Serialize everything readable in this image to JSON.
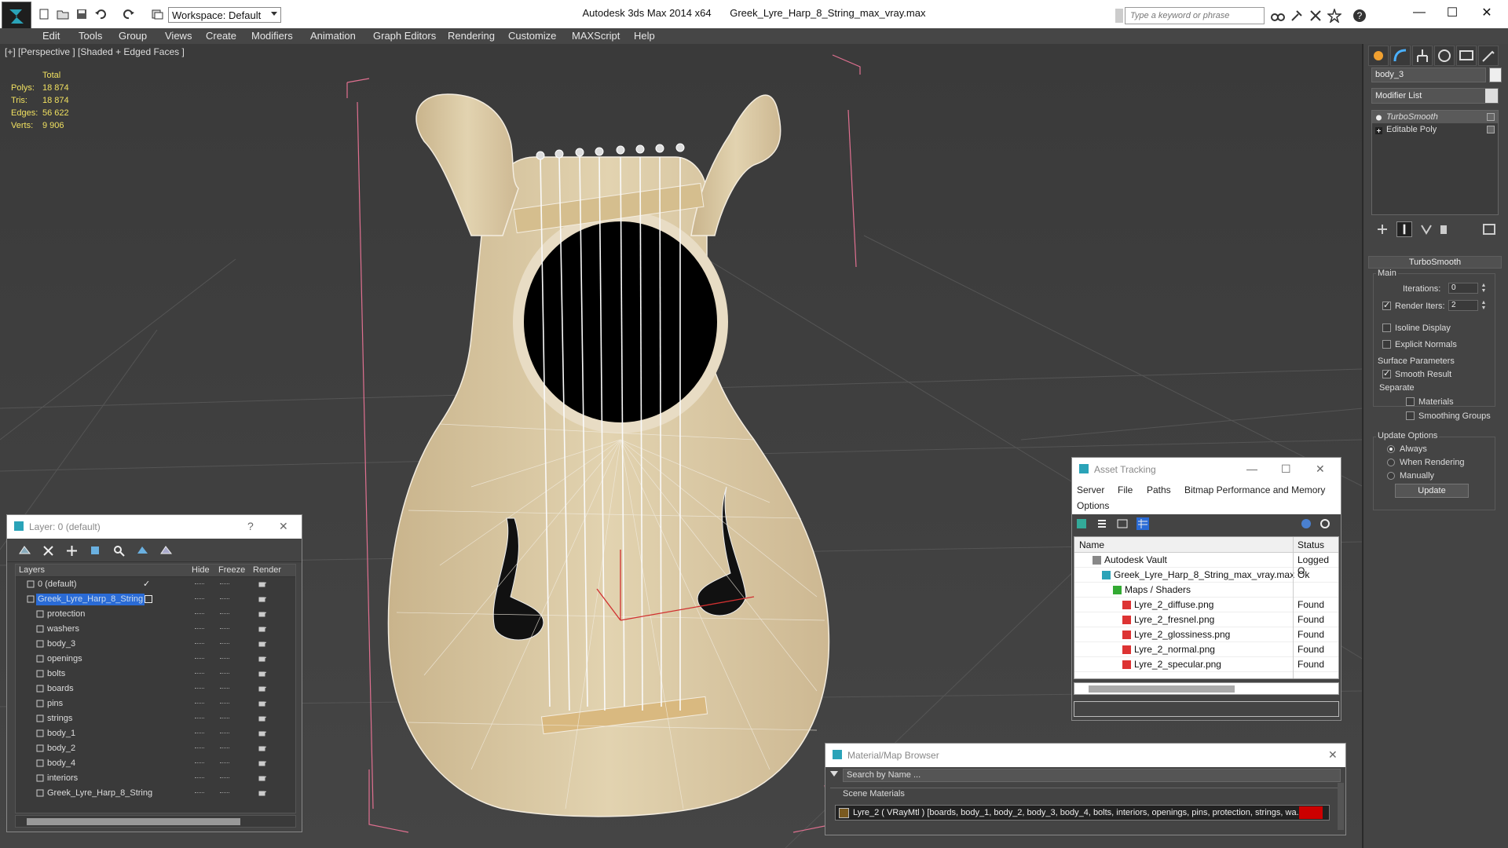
{
  "titlebar": {
    "workspace": "Workspace: Default",
    "app_name": "Autodesk 3ds Max  2014 x64",
    "file_name": "Greek_Lyre_Harp_8_String_max_vray.max",
    "search_placeholder": "Type a keyword or phrase",
    "minimize": "—",
    "maximize": "☐",
    "close": "✕"
  },
  "menubar": {
    "items": [
      "Edit",
      "Tools",
      "Group",
      "Views",
      "Create",
      "Modifiers",
      "Animation",
      "Graph Editors",
      "Rendering",
      "Customize",
      "MAXScript",
      "Help"
    ]
  },
  "viewport": {
    "label": "[+] [Perspective ] [Shaded + Edged Faces ]",
    "stats": {
      "header": "Total",
      "rows": [
        {
          "k": "Polys:",
          "v": "18 874"
        },
        {
          "k": "Tris:",
          "v": "18 874"
        },
        {
          "k": "Edges:",
          "v": "56 622"
        },
        {
          "k": "Verts:",
          "v": "9 906"
        }
      ]
    }
  },
  "command_panel": {
    "object_name": "body_3",
    "modifier_list": "Modifier List",
    "stack": [
      "TurboSmooth",
      "Editable Poly"
    ],
    "rollout_title": "TurboSmooth",
    "main_group": "Main",
    "iterations_label": "Iterations:",
    "iterations_value": "0",
    "render_iters_label": "Render Iters:",
    "render_iters_value": "2",
    "isoline_label": "Isoline Display",
    "explicit_normals_label": "Explicit Normals",
    "surface_group": "Surface Parameters",
    "smooth_result_label": "Smooth Result",
    "separate_label": "Separate",
    "materials_label": "Materials",
    "smoothing_groups_label": "Smoothing Groups",
    "update_group": "Update Options",
    "always_label": "Always",
    "when_rendering_label": "When Rendering",
    "manually_label": "Manually",
    "update_button": "Update"
  },
  "layer_window": {
    "title": "Layer: 0 (default)",
    "help": "?",
    "close": "✕",
    "columns": {
      "layers": "Layers",
      "hide": "Hide",
      "freeze": "Freeze",
      "render": "Render"
    },
    "rows": [
      {
        "name": "0 (default)",
        "indent": 0,
        "selected": false
      },
      {
        "name": "Greek_Lyre_Harp_8_String",
        "indent": 0,
        "selected": true
      },
      {
        "name": "protection",
        "indent": 1,
        "selected": false
      },
      {
        "name": "washers",
        "indent": 1,
        "selected": false
      },
      {
        "name": "body_3",
        "indent": 1,
        "selected": false
      },
      {
        "name": "openings",
        "indent": 1,
        "selected": false
      },
      {
        "name": "bolts",
        "indent": 1,
        "selected": false
      },
      {
        "name": "boards",
        "indent": 1,
        "selected": false
      },
      {
        "name": "pins",
        "indent": 1,
        "selected": false
      },
      {
        "name": "strings",
        "indent": 1,
        "selected": false
      },
      {
        "name": "body_1",
        "indent": 1,
        "selected": false
      },
      {
        "name": "body_2",
        "indent": 1,
        "selected": false
      },
      {
        "name": "body_4",
        "indent": 1,
        "selected": false
      },
      {
        "name": "interiors",
        "indent": 1,
        "selected": false
      },
      {
        "name": "Greek_Lyre_Harp_8_String",
        "indent": 1,
        "selected": false
      }
    ]
  },
  "asset_window": {
    "title": "Asset Tracking",
    "menu": [
      "Server",
      "File",
      "Paths",
      "Bitmap Performance and Memory",
      "Options"
    ],
    "columns": {
      "name": "Name",
      "status": "Status"
    },
    "rows": [
      {
        "name": "Autodesk Vault",
        "status": "Logged O"
      },
      {
        "name": "Greek_Lyre_Harp_8_String_max_vray.max",
        "status": "Ok"
      },
      {
        "name": "Maps / Shaders",
        "status": ""
      },
      {
        "name": "Lyre_2_diffuse.png",
        "status": "Found"
      },
      {
        "name": "Lyre_2_fresnel.png",
        "status": "Found"
      },
      {
        "name": "Lyre_2_glossiness.png",
        "status": "Found"
      },
      {
        "name": "Lyre_2_normal.png",
        "status": "Found"
      },
      {
        "name": "Lyre_2_specular.png",
        "status": "Found"
      }
    ]
  },
  "material_browser": {
    "title": "Material/Map Browser",
    "search_placeholder": "Search by Name ...",
    "section": "Scene Materials",
    "entry": "Lyre_2 ( VRayMtl ) [boards, body_1, body_2, body_3, body_4, bolts, interiors, openings, pins, protection, strings, wa..."
  },
  "colors": {
    "viewport_bg": "#3c3c3c",
    "wood": "#d9c8a4",
    "selection_blue": "#2a6bd6",
    "stats_yellow": "#f0e060"
  }
}
